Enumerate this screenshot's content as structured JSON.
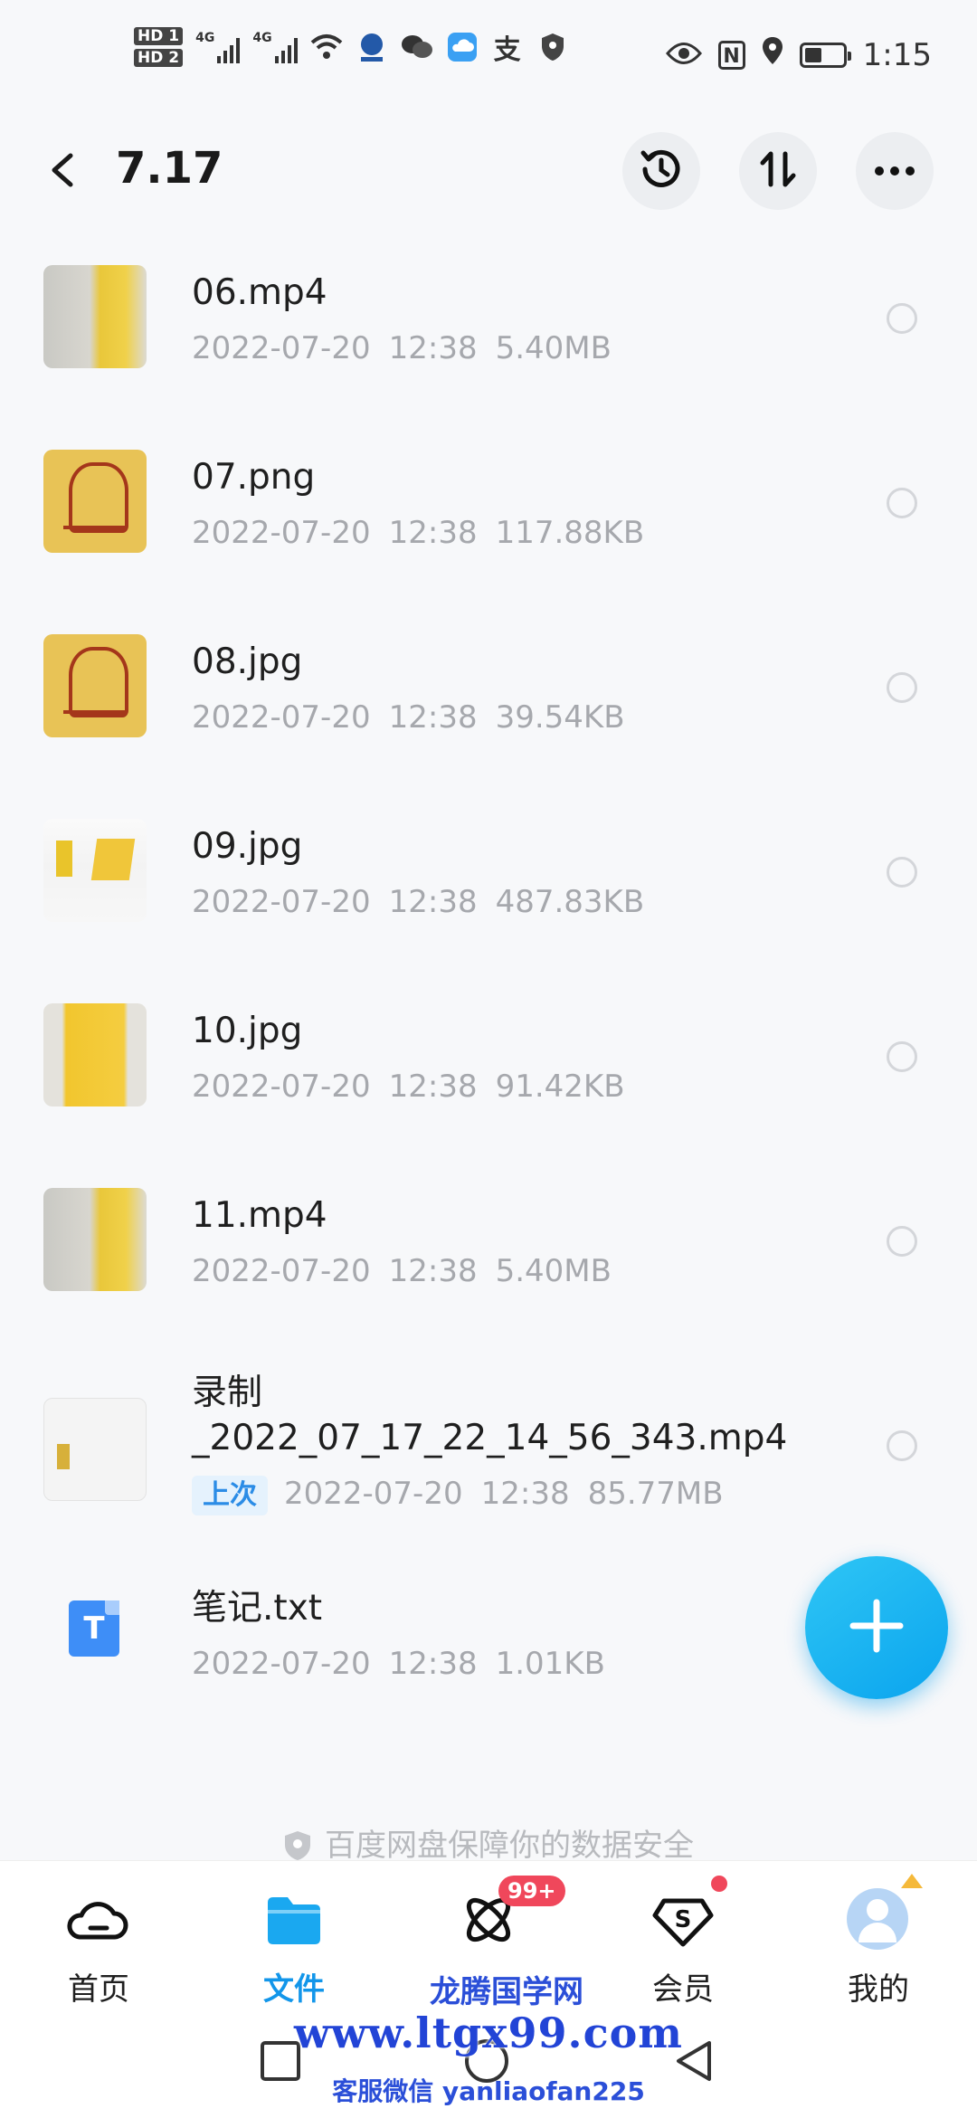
{
  "status_bar": {
    "hd1": "HD 1",
    "hd2": "HD 2",
    "net1": "4G",
    "net2": "4G",
    "time": "1:15",
    "nfc": "N",
    "alipay": "支"
  },
  "header": {
    "title": "7.17"
  },
  "files": [
    {
      "name": "06.mp4",
      "date": "2022-07-20",
      "time": "12:38",
      "size": "5.40MB",
      "thumb": "video"
    },
    {
      "name": "07.png",
      "date": "2022-07-20",
      "time": "12:38",
      "size": "117.88KB",
      "thumb": "talisman"
    },
    {
      "name": "08.jpg",
      "date": "2022-07-20",
      "time": "12:38",
      "size": "39.54KB",
      "thumb": "talisman"
    },
    {
      "name": "09.jpg",
      "date": "2022-07-20",
      "time": "12:38",
      "size": "487.83KB",
      "thumb": "photo"
    },
    {
      "name": "10.jpg",
      "date": "2022-07-20",
      "time": "12:38",
      "size": "91.42KB",
      "thumb": "yellow"
    },
    {
      "name": "11.mp4",
      "date": "2022-07-20",
      "time": "12:38",
      "size": "5.40MB",
      "thumb": "video"
    },
    {
      "name_line1": "录制",
      "name_line2": "_2022_07_17_22_14_56_343.mp4",
      "tag": "上次",
      "date": "2022-07-20",
      "time": "12:38",
      "size": "85.77MB",
      "thumb": "screen"
    },
    {
      "name": "笔记.txt",
      "date": "2022-07-20",
      "time": "12:38",
      "size": "1.01KB",
      "thumb": "txt",
      "icon_letter": "T"
    }
  ],
  "security_note": "百度网盘保障你的数据安全",
  "bottom_nav": {
    "tabs": [
      {
        "label": "首页",
        "icon": "cloud-home-icon"
      },
      {
        "label": "文件",
        "icon": "folder-icon",
        "active": true
      },
      {
        "label": "",
        "icon": "atom-icon",
        "badge": "99+"
      },
      {
        "label": "会员",
        "icon": "vip-diamond-icon",
        "dot": true
      },
      {
        "label": "我的",
        "icon": "avatar-icon"
      }
    ]
  },
  "watermark": {
    "top": "龙腾国学网",
    "main": "www.ltgx99.com",
    "bottom": "客服微信 yanliaofan225"
  },
  "colors": {
    "accent": "#1296ea",
    "fab": "#12aaf0",
    "badge": "#f0475b",
    "meta_text": "#a6a8ad"
  }
}
